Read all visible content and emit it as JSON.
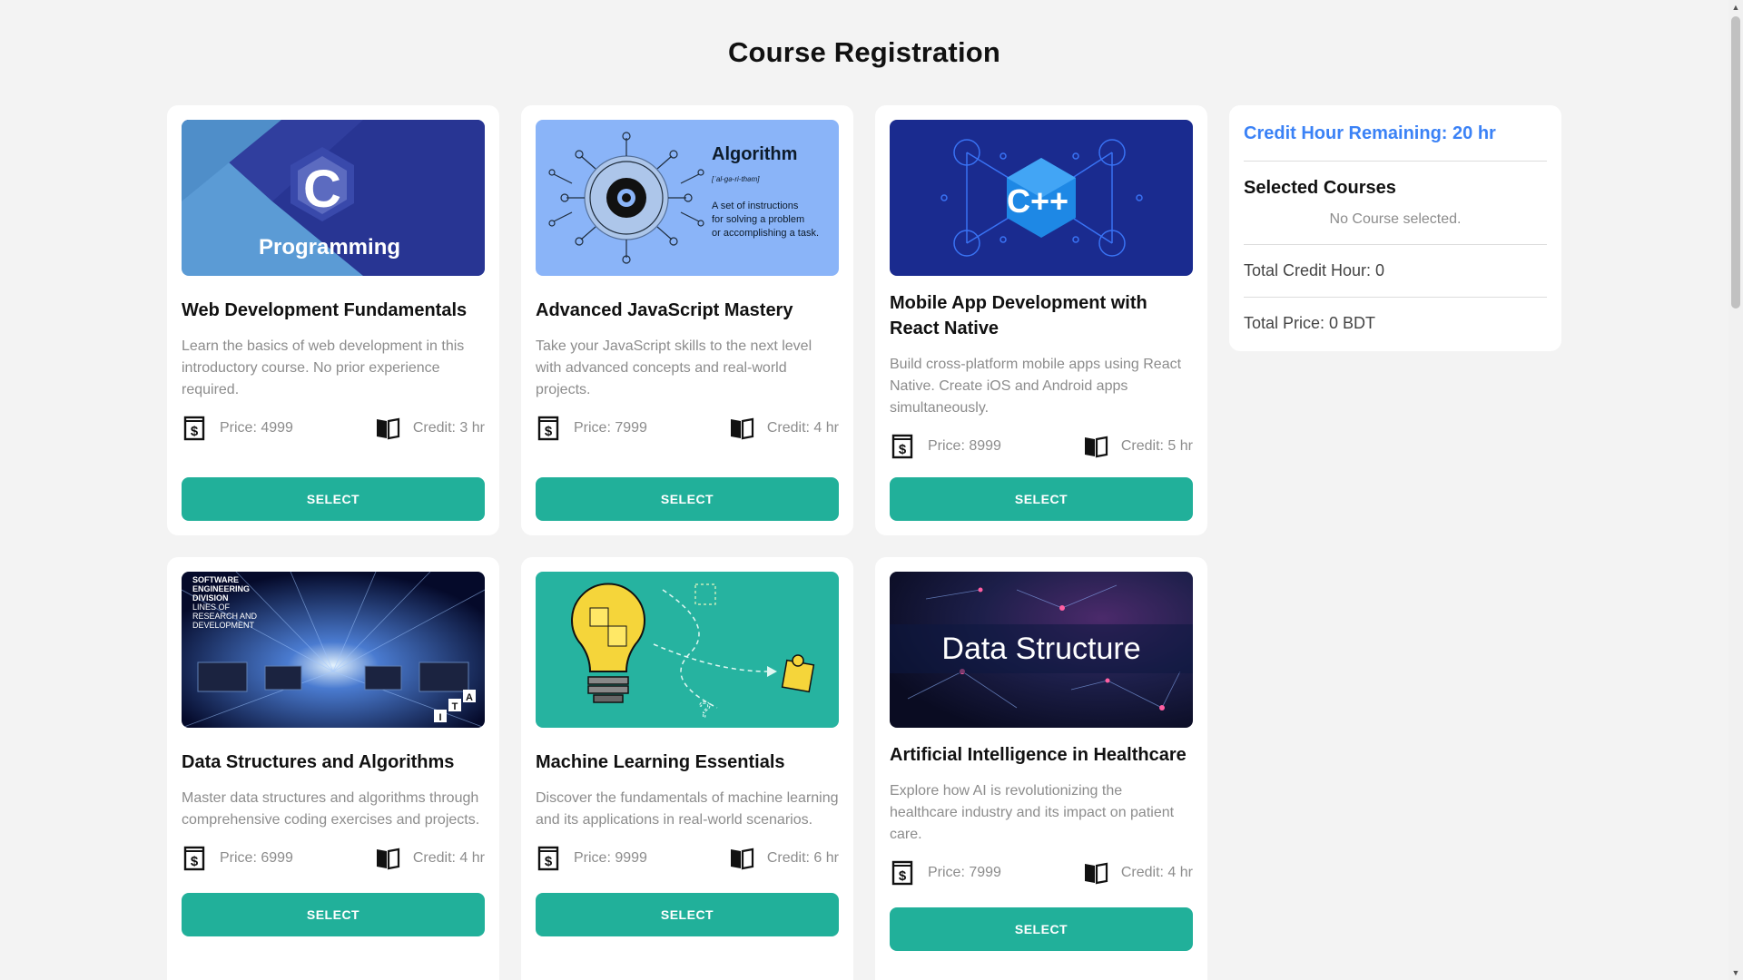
{
  "page": {
    "title": "Course Registration"
  },
  "courses": [
    {
      "title": "Web Development Fundamentals",
      "description": "Learn the basics of web development in this introductory course. No prior experience required.",
      "price": "Price: 4999",
      "credit": "Credit: 3 hr",
      "button": "SELECT",
      "image": {
        "kind": "c-programming",
        "text": "Programming",
        "letter": "C"
      }
    },
    {
      "title": "Advanced JavaScript Mastery",
      "description": "Take your JavaScript skills to the next level with advanced concepts and real-world projects.",
      "price": "Price: 7999",
      "credit": "Credit: 4 hr",
      "button": "SELECT",
      "image": {
        "kind": "algorithm",
        "heading": "Algorithm",
        "phonetic": "[ˈal-gə-ri-thəm]",
        "line1": "A set of instructions",
        "line2": "for solving a problem",
        "line3": "or accomplishing a task."
      }
    },
    {
      "title": "Mobile App Development with React Native",
      "description": "Build cross-platform mobile apps using React Native. Create iOS and Android apps simultaneously.",
      "price": "Price: 8999",
      "credit": "Credit: 5 hr",
      "button": "SELECT",
      "image": {
        "kind": "cpp",
        "letter": "C++"
      }
    },
    {
      "title": "Data Structures and Algorithms",
      "description": "Master data structures and algorithms through comprehensive coding exercises and projects.",
      "price": "Price: 6999",
      "credit": "Credit: 4 hr",
      "button": "SELECT",
      "image": {
        "kind": "software-eng",
        "line1": "SOFTWARE",
        "line2": "ENGINEERING",
        "line3": "DIVISION",
        "line4": "LINES OF",
        "line5": "RESEARCH AND",
        "line6": "DEVELOPMENT",
        "badge1": "T",
        "badge2": "A",
        "badge3": "I"
      }
    },
    {
      "title": "Machine Learning Essentials",
      "description": "Discover the fundamentals of machine learning and its applications in real-world scenarios.",
      "price": "Price: 9999",
      "credit": "Credit: 6 hr",
      "button": "SELECT",
      "image": {
        "kind": "lightbulb-puzzle"
      }
    },
    {
      "title": "Artificial Intelligence in Healthcare",
      "description": "Explore how AI is revolutionizing the healthcare industry and its impact on patient care.",
      "price": "Price: 7999",
      "credit": "Credit: 4 hr",
      "button": "SELECT",
      "image": {
        "kind": "data-structure",
        "text": "Data Structure"
      }
    }
  ],
  "sidebar": {
    "remaining": "Credit Hour Remaining: 20 hr",
    "selected_heading": "Selected Courses",
    "empty_text": "No Course selected.",
    "total_credit": "Total Credit Hour: 0",
    "total_price": "Total Price: 0 BDT"
  },
  "colors": {
    "accent": "#21b09a",
    "remaining": "#3b82f6",
    "background": "#f3f3f3"
  },
  "icons": {
    "price": "dollar-icon",
    "credit": "book-icon"
  }
}
